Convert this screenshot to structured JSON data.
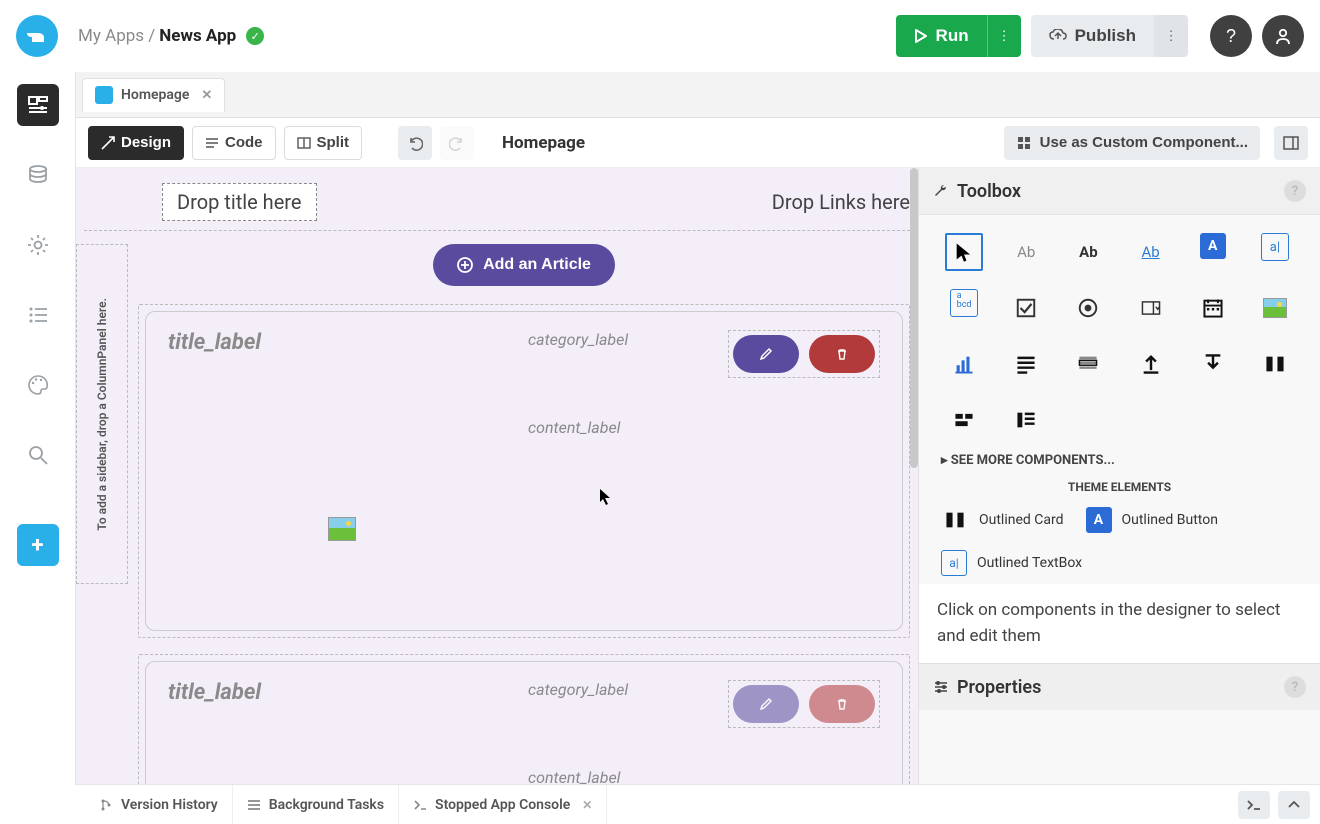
{
  "breadcrumb": {
    "parent": "My Apps / ",
    "current": "News App"
  },
  "run_label": "Run",
  "publish_label": "Publish",
  "tab": {
    "label": "Homepage"
  },
  "toolbar": {
    "design": "Design",
    "code": "Code",
    "split": "Split",
    "page_name": "Homepage",
    "custom_component": "Use as Custom Component..."
  },
  "canvas": {
    "drop_title": "Drop title here",
    "drop_links": "Drop Links here",
    "sidebar_hint": "To add a sidebar, drop a ColumnPanel here.",
    "add_article": "Add an Article",
    "title_label": "title_label",
    "category_label": "category_label",
    "content_label": "content_label"
  },
  "rightpanel": {
    "toolbox": "Toolbox",
    "see_more": "SEE MORE COMPONENTS...",
    "theme_header": "THEME ELEMENTS",
    "outlined_card": "Outlined Card",
    "outlined_button": "Outlined Button",
    "outlined_textbox": "Outlined TextBox",
    "hint": "Click on components in the designer to select and edit them",
    "properties": "Properties"
  },
  "bottombar": {
    "version_history": "Version History",
    "background_tasks": "Background Tasks",
    "stopped_console": "Stopped App Console"
  }
}
